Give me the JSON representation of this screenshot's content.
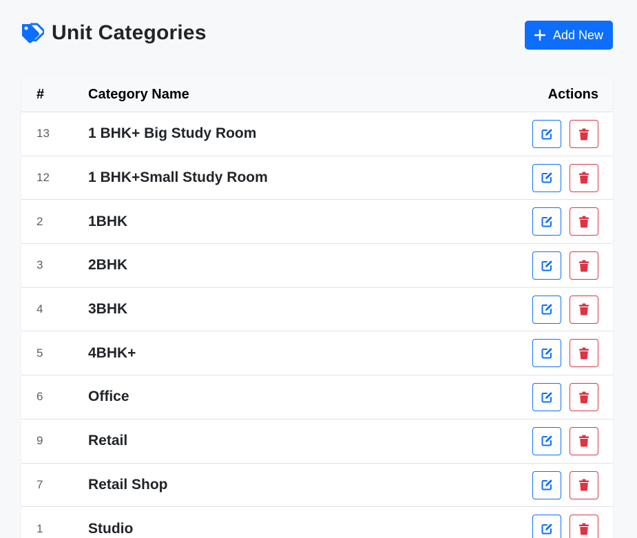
{
  "page": {
    "title": "Unit Categories",
    "title_icon": "tags-icon",
    "add_button_label": "Add New",
    "add_button_icon": "plus-icon"
  },
  "table": {
    "columns": [
      "#",
      "Category Name",
      "Actions"
    ],
    "rows": [
      {
        "id": "13",
        "name": "1 BHK+ Big Study Room"
      },
      {
        "id": "12",
        "name": "1 BHK+Small Study Room"
      },
      {
        "id": "2",
        "name": "1BHK"
      },
      {
        "id": "3",
        "name": "2BHK"
      },
      {
        "id": "4",
        "name": "3BHK"
      },
      {
        "id": "5",
        "name": "4BHK+"
      },
      {
        "id": "6",
        "name": "Office"
      },
      {
        "id": "9",
        "name": "Retail"
      },
      {
        "id": "7",
        "name": "Retail Shop"
      },
      {
        "id": "1",
        "name": "Studio"
      }
    ],
    "row_actions": [
      {
        "name": "edit",
        "icon": "edit-icon"
      },
      {
        "name": "delete",
        "icon": "trash-icon"
      }
    ]
  },
  "colors": {
    "primary": "#0d6efd",
    "danger": "#dc3545",
    "page_background": "#f7f8fa",
    "text": "#212529"
  }
}
